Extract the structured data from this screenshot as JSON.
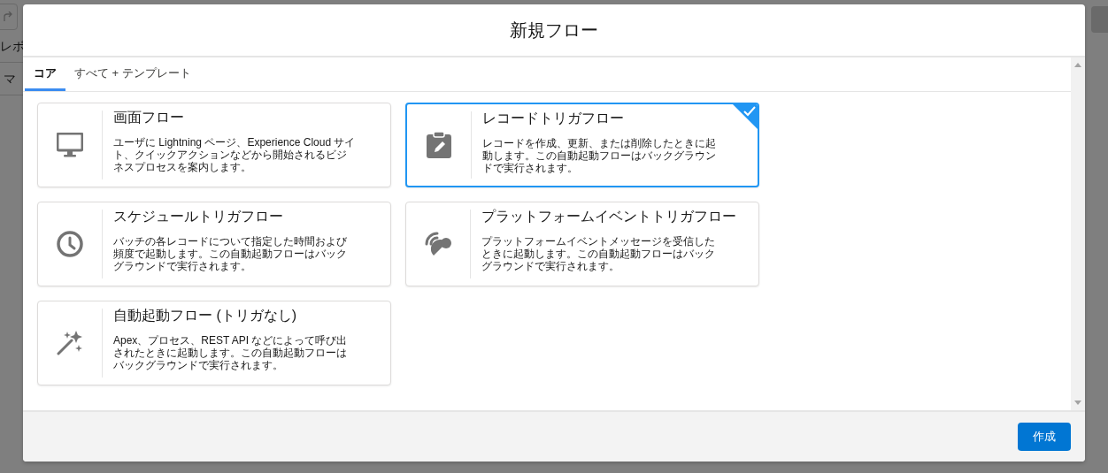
{
  "background": {
    "labels": [
      {
        "text": "レボ"
      },
      {
        "text": "マ"
      }
    ]
  },
  "dialog": {
    "title": "新規フロー",
    "tabs": [
      {
        "label": "コア",
        "selected": true
      },
      {
        "label": "すべて + テンプレート",
        "selected": false
      }
    ],
    "flow_types": [
      {
        "kind": "screen",
        "title": "画面フロー",
        "description": "ユーザに Lightning ページ、Experience Cloud サイト、クイックアクションなどから開始されるビジネスプロセスを案内します。",
        "selected": false
      },
      {
        "kind": "record",
        "title": "レコードトリガフロー",
        "description": "レコードを作成、更新、または削除したときに起動します。この自動起動フローはバックグラウンドで実行されます。",
        "selected": true
      },
      {
        "kind": "schedule",
        "title": "スケジュールトリガフロー",
        "description": "バッチの各レコードについて指定した時間および頻度で起動します。この自動起動フローはバックグラウンドで実行されます。",
        "selected": false
      },
      {
        "kind": "platform",
        "title": "プラットフォームイベントトリガフロー",
        "description": "プラットフォームイベントメッセージを受信したときに起動します。この自動起動フローはバックグラウンドで実行されます。",
        "selected": false
      },
      {
        "kind": "autolaunched",
        "title": "自動起動フロー (トリガなし)",
        "description": "Apex、プロセス、REST API などによって呼び出されたときに起動します。この自動起動フローはバックグラウンドで実行されます。",
        "selected": false
      }
    ],
    "create_button": "作成"
  }
}
